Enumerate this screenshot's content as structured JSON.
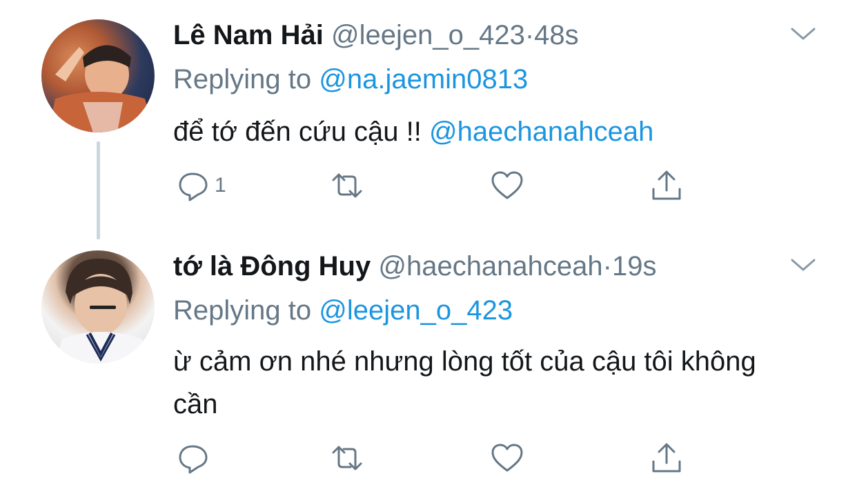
{
  "tweets": [
    {
      "name": "Lê Nam Hải",
      "handle": "@leejen_o_423",
      "separator": "·",
      "time": "48s",
      "replying_prefix": "Replying to",
      "replying_to": "@na.jaemin0813",
      "text": "để tớ đến cứu cậu !!",
      "text_mention": "@haechanahceah",
      "reply_count": "1",
      "icons": [
        "reply-icon",
        "retweet-icon",
        "like-icon",
        "share-icon",
        "chevron-down-icon"
      ]
    },
    {
      "name": "tớ là Đông Huy",
      "handle": "@haechanahceah",
      "separator": "·",
      "time": "19s",
      "replying_prefix": "Replying to",
      "replying_to": "@leejen_o_423",
      "text": "ừ cảm ơn nhé nhưng lòng tốt của cậu tôi không cần",
      "reply_count": "",
      "icons": [
        "reply-icon",
        "retweet-icon",
        "like-icon",
        "share-icon",
        "chevron-down-icon"
      ]
    }
  ],
  "colors": {
    "text": "#14171a",
    "secondary": "#657786",
    "link": "#1b95e0",
    "thread_line": "#ccd6dd"
  }
}
